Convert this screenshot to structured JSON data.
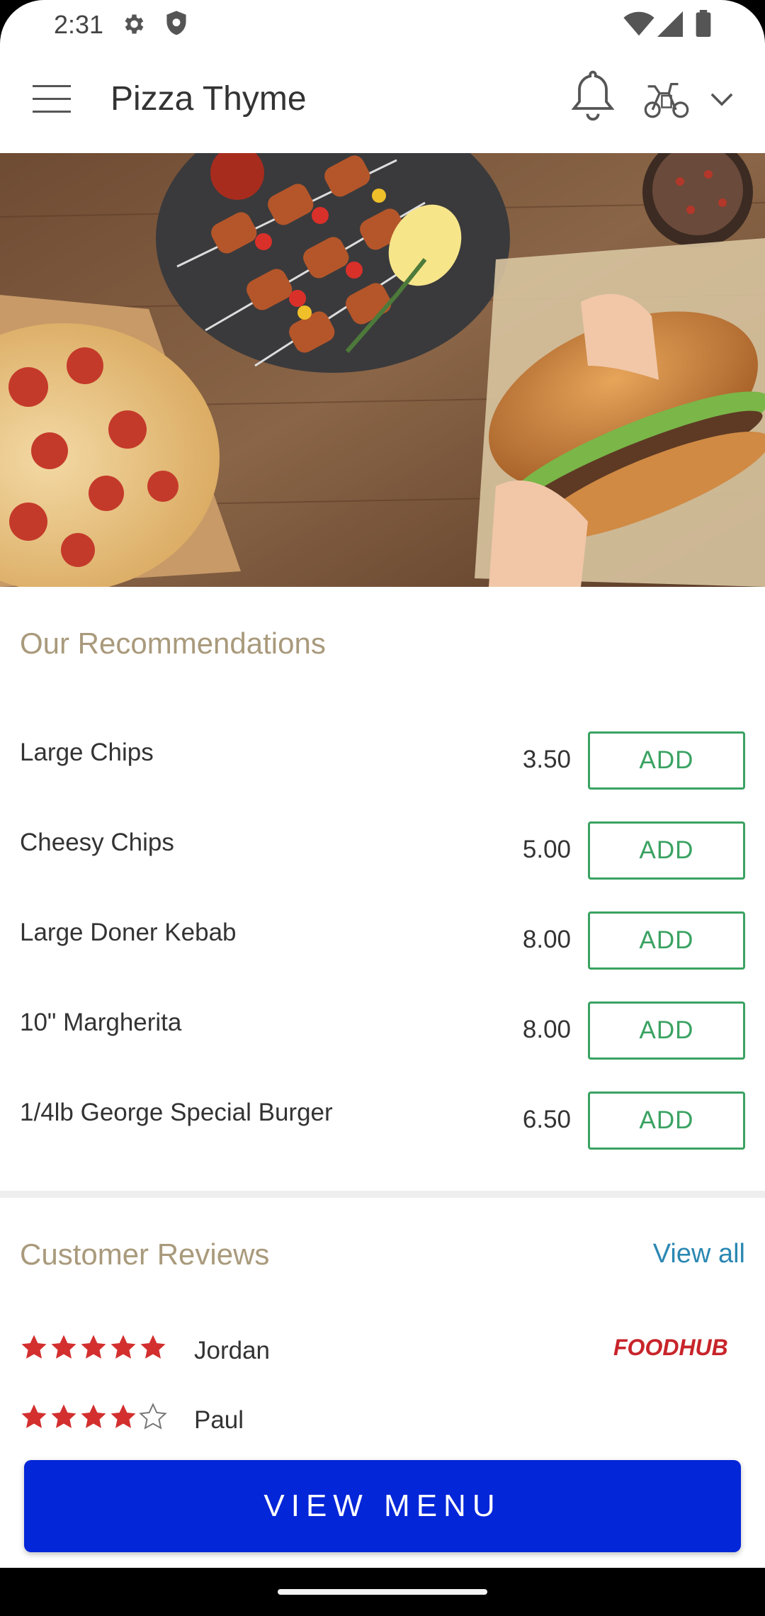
{
  "status_bar": {
    "time": "2:31"
  },
  "app_bar": {
    "title": "Pizza Thyme"
  },
  "hero": {
    "image": "food-banner-pizza-kebab-burger"
  },
  "recommendations": {
    "title": "Our Recommendations",
    "items": [
      {
        "name": "Large Chips",
        "price": "3.50",
        "button": "ADD"
      },
      {
        "name": "Cheesy Chips",
        "price": "5.00",
        "button": "ADD"
      },
      {
        "name": "Large Doner Kebab",
        "price": "8.00",
        "button": "ADD"
      },
      {
        "name": "10\" Margherita",
        "price": "8.00",
        "button": "ADD"
      },
      {
        "name": "1/4lb George Special Burger",
        "price": "6.50",
        "button": "ADD"
      }
    ]
  },
  "reviews": {
    "title": "Customer Reviews",
    "view_all": "View all",
    "items": [
      {
        "name": "Jordan",
        "rating": 5,
        "source": "FOODHUB"
      },
      {
        "name": "Paul",
        "rating": 4
      }
    ]
  },
  "cta": {
    "label": "VIEW MENU"
  },
  "colors": {
    "accent_green": "#3aa262",
    "heading_tan": "#a99a7c",
    "link_blue": "#2b88b2",
    "primary_button": "#0326d8",
    "star_red": "#d32f2f"
  }
}
